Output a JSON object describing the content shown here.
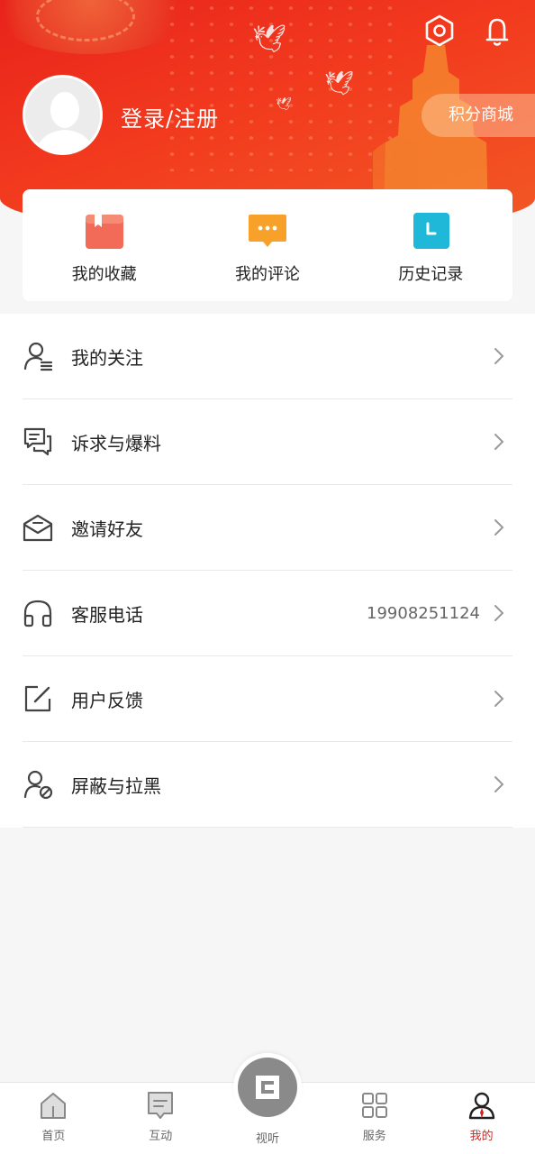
{
  "header": {
    "login_label": "登录/注册",
    "points_mall_label": "积分商城",
    "settings_icon": "settings-hexagon-icon",
    "notification_icon": "bell-icon",
    "colors": {
      "primary": "#e8231b",
      "accent": "#f25a25"
    }
  },
  "quick_actions": [
    {
      "label": "我的收藏",
      "icon": "bookmark-icon",
      "color": "#f26b58"
    },
    {
      "label": "我的评论",
      "icon": "comment-icon",
      "color": "#f7a02a"
    },
    {
      "label": "历史记录",
      "icon": "clock-icon",
      "color": "#1fb8d8"
    }
  ],
  "menu": [
    {
      "label": "我的关注",
      "icon": "user-list-icon",
      "value": ""
    },
    {
      "label": "诉求与爆料",
      "icon": "chat-bubbles-icon",
      "value": ""
    },
    {
      "label": "邀请好友",
      "icon": "envelope-icon",
      "value": ""
    },
    {
      "label": "客服电话",
      "icon": "headphones-icon",
      "value": "19908251124"
    },
    {
      "label": "用户反馈",
      "icon": "edit-icon",
      "value": ""
    },
    {
      "label": "屏蔽与拉黑",
      "icon": "user-block-icon",
      "value": ""
    }
  ],
  "tabbar": {
    "items": [
      {
        "label": "首页",
        "icon": "home-icon"
      },
      {
        "label": "互动",
        "icon": "message-icon"
      },
      {
        "label": "视听",
        "icon": "video-center-icon"
      },
      {
        "label": "服务",
        "icon": "grid-icon"
      },
      {
        "label": "我的",
        "icon": "user-icon",
        "active": true
      }
    ],
    "active_color": "#d22222"
  }
}
